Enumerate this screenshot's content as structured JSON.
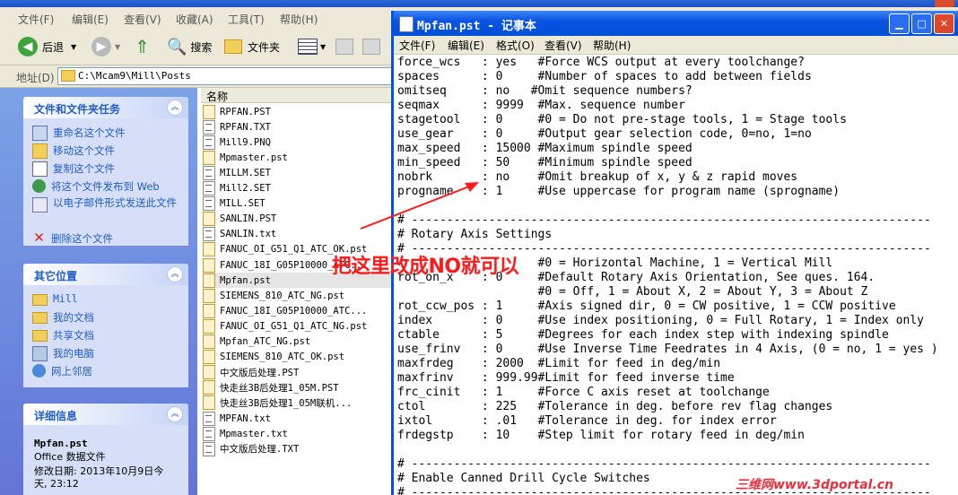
{
  "explorer": {
    "title": "",
    "menu": [
      "文件(F)",
      "编辑(E)",
      "查看(V)",
      "收藏(A)",
      "工具(T)",
      "帮助(H)"
    ],
    "toolbar": {
      "back": "后退",
      "search": "搜索",
      "folders": "文件夹"
    },
    "address": {
      "label": "地址(D)",
      "path": "C:\\Mcam9\\Mill\\Posts"
    },
    "tasks": {
      "title": "文件和文件夹任务",
      "items": [
        "重命名这个文件",
        "移动这个文件",
        "复制这个文件",
        "将这个文件发布到 Web",
        "以电子邮件形式发送此文件",
        "删除这个文件"
      ]
    },
    "other_places": {
      "title": "其它位置",
      "items": [
        "Mill",
        "我的文档",
        "共享文档",
        "我的电脑",
        "网上邻居"
      ]
    },
    "details": {
      "title": "详细信息",
      "name": "Mpfan.pst",
      "type": "Office 数据文件",
      "modified_line1": "修改日期: 2013年10月9日今",
      "modified_line2": "天, 23:12"
    },
    "column_header": "名称",
    "files": [
      "RPFAN.PST",
      "RPFAN.TXT",
      "Mill9.PNQ",
      "Mpmaster.pst",
      "MILLM.SET",
      "Mill2.SET",
      "MILL.SET",
      "SANLIN.PST",
      "SANLIN.txt",
      "FANUC_OI_G51_Q1_ATC_OK.pst",
      "FANUC_18I_G05P10000_ATC...",
      "Mpfan.pst",
      "SIEMENS_810_ATC_NG.pst",
      "FANUC_18I_G05P10000_ATC...",
      "FANUC_OI_G51_Q1_ATC_NG.pst",
      "Mpfan_ATC_NG.pst",
      "SIEMENS_810_ATC_OK.pst",
      "中文版后处理.PST",
      "快走丝3B后处理1_05M.PST",
      "快走丝3B后处理1_05M联机...",
      "MPFAN.txt",
      "Mpmaster.txt",
      "中文版后处理.TXT"
    ]
  },
  "notepad": {
    "title": "Mpfan.pst - 记事本",
    "menu": [
      "文件(F)",
      "编辑(E)",
      "格式(O)",
      "查看(V)",
      "帮助(H)"
    ],
    "lines": [
      "force_wcs   : yes   #Force WCS output at every toolchange?",
      "spaces      : 0     #Number of spaces to add between fields",
      "omitseq     : no   #Omit sequence numbers?",
      "seqmax      : 9999  #Max. sequence number",
      "stagetool   : 0     #0 = Do not pre-stage tools, 1 = Stage tools",
      "use_gear    : 0     #Output gear selection code, 0=no, 1=no",
      "max_speed   : 15000 #Maximum spindle speed",
      "min_speed   : 50    #Minimum spindle speed",
      "nobrk       : no    #Omit breakup of x, y & z rapid moves",
      "progname    : 1     #Use uppercase for program name (sprogname)",
      "",
      "# --------------------------------------------------------------------------",
      "# Rotary Axis Settings",
      "# --------------------------------------------------------------------------",
      "                    #0 = Horizontal Machine, 1 = Vertical Mill",
      "rot_on_x    : 0     #Default Rotary Axis Orientation, See ques. 164.",
      "                    #0 = Off, 1 = About X, 2 = About Y, 3 = About Z",
      "rot_ccw_pos : 1     #Axis signed dir, 0 = CW positive, 1 = CCW positive",
      "index       : 0     #Use index positioning, 0 = Full Rotary, 1 = Index only",
      "ctable      : 5     #Degrees for each index step with indexing spindle",
      "use_frinv   : 0     #Use Inverse Time Feedrates in 4 Axis, (0 = no, 1 = yes )",
      "maxfrdeg    : 2000  #Limit for feed in deg/min",
      "maxfrinv    : 999.99#Limit for feed inverse time",
      "frc_cinit   : 1     #Force C axis reset at toolchange",
      "ctol        : 225   #Tolerance in deg. before rev flag changes",
      "ixtol       : .01   #Tolerance in deg. for index error",
      "frdegstp    : 10    #Step limit for rotary feed in deg/min",
      "",
      "# --------------------------------------------------------------------------",
      "# Enable Canned Drill Cycle Switches",
      "# --------------------------------------------------------------------------"
    ]
  },
  "annotation": {
    "text": "把这里改成NO就可以",
    "color": "#ff1a1a"
  },
  "watermark": "三维网www.3dportal.cn"
}
